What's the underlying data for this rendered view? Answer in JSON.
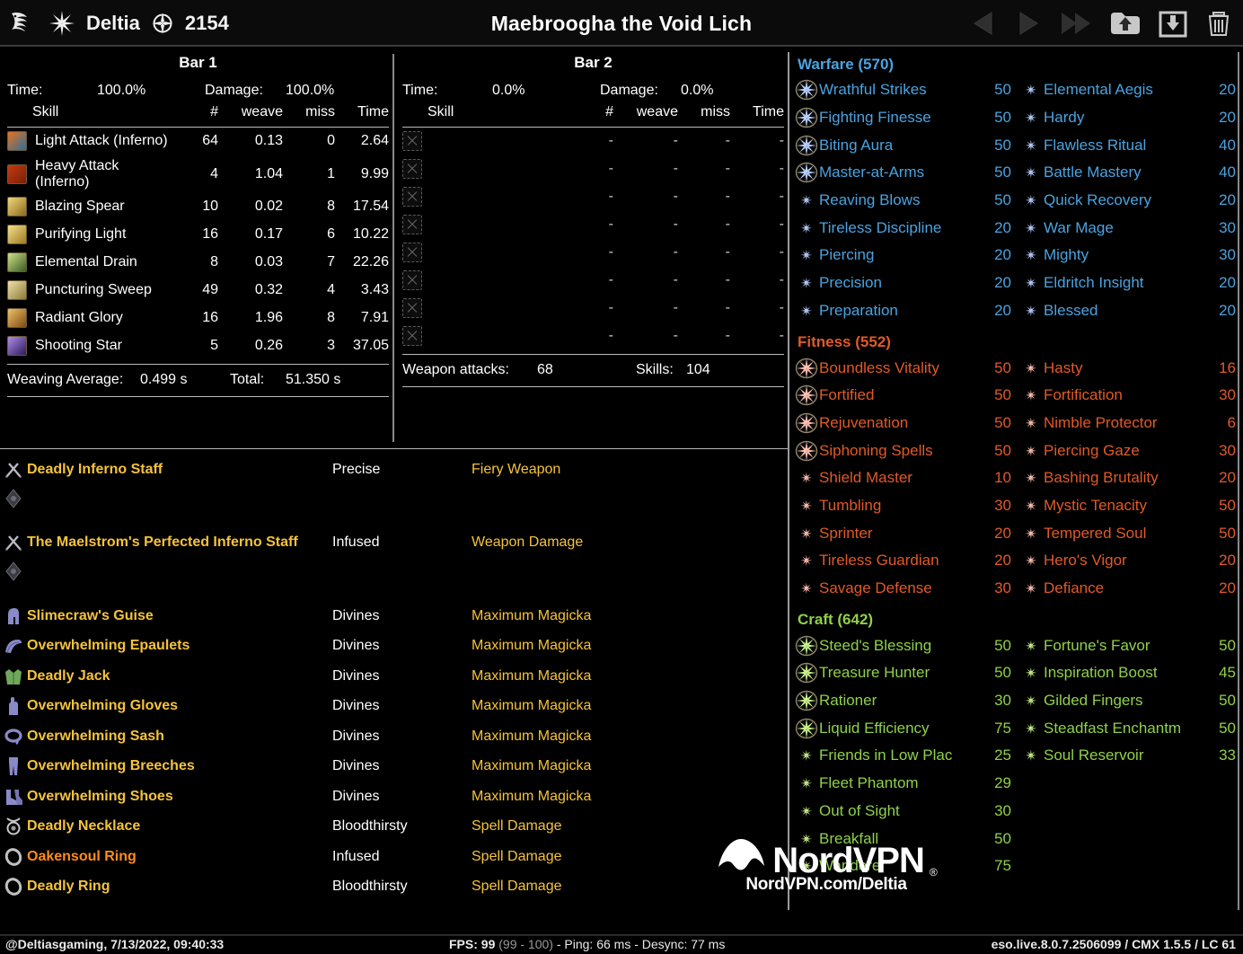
{
  "header": {
    "player_name": "Deltia",
    "cp_count": "2154",
    "title": "Maebroogha the Void Lich",
    "nav_icons": [
      "previous-icon",
      "play-icon",
      "fast-forward-icon",
      "upload-icon",
      "download-icon",
      "trash-icon"
    ]
  },
  "bar1": {
    "title": "Bar 1",
    "time_label": "Time:",
    "time_value": "100.0%",
    "damage_label": "Damage:",
    "damage_value": "100.0%",
    "columns": [
      "Skill",
      "#",
      "weave",
      "miss",
      "Time"
    ],
    "rows": [
      {
        "icon": "light-attack-inferno-icon",
        "name": "Light Attack (Inferno)",
        "count": "64",
        "weave": "0.13",
        "miss": "0",
        "time": "2.64",
        "c1": "#e8731e",
        "c2": "#2c6f9e"
      },
      {
        "icon": "heavy-attack-inferno-icon",
        "name": "Heavy Attack (Inferno)",
        "count": "4",
        "weave": "1.04",
        "miss": "1",
        "time": "9.99",
        "c1": "#c23b10",
        "c2": "#7a1f08"
      },
      {
        "icon": "blazing-spear-icon",
        "name": "Blazing Spear",
        "count": "10",
        "weave": "0.02",
        "miss": "8",
        "time": "17.54",
        "c1": "#f3d77a",
        "c2": "#8a6a1e"
      },
      {
        "icon": "purifying-light-icon",
        "name": "Purifying Light",
        "count": "16",
        "weave": "0.17",
        "miss": "6",
        "time": "10.22",
        "c1": "#f7e08a",
        "c2": "#9a7b22"
      },
      {
        "icon": "elemental-drain-icon",
        "name": "Elemental Drain",
        "count": "8",
        "weave": "0.03",
        "miss": "7",
        "time": "22.26",
        "c1": "#cfe08a",
        "c2": "#3a5a22"
      },
      {
        "icon": "puncturing-sweep-icon",
        "name": "Puncturing Sweep",
        "count": "49",
        "weave": "0.32",
        "miss": "4",
        "time": "3.43",
        "c1": "#f0e2a8",
        "c2": "#8b7a3a"
      },
      {
        "icon": "radiant-glory-icon",
        "name": "Radiant Glory",
        "count": "16",
        "weave": "1.96",
        "miss": "8",
        "time": "7.91",
        "c1": "#f0c268",
        "c2": "#7a4a14"
      },
      {
        "icon": "shooting-star-icon",
        "name": "Shooting Star",
        "count": "5",
        "weave": "0.26",
        "miss": "3",
        "time": "37.05",
        "c1": "#b08ce8",
        "c2": "#2a1a5a"
      }
    ],
    "footer_left_label": "Weaving Average:",
    "footer_left_value": "0.499 s",
    "footer_right_label": "Total:",
    "footer_right_value": "51.350 s"
  },
  "bar2": {
    "title": "Bar 2",
    "time_label": "Time:",
    "time_value": "0.0%",
    "damage_label": "Damage:",
    "damage_value": "0.0%",
    "columns": [
      "Skill",
      "#",
      "weave",
      "miss",
      "Time"
    ],
    "empty_marker": "-",
    "empty_row_count": 8,
    "footer_left_label": "Weapon attacks:",
    "footer_left_value": "68",
    "footer_right_label": "Skills:",
    "footer_right_value": "104"
  },
  "gear": {
    "rows": [
      {
        "icon": "weapon-icon",
        "name": "Deadly Inferno Staff",
        "trait": "Precise",
        "ench": "Fiery Weapon",
        "color": "gold",
        "sub": "glyph-icon"
      },
      {
        "icon": "weapon-icon",
        "name": "The Maelstrom's Perfected Inferno Staff",
        "trait": "Infused",
        "ench": "Weapon Damage",
        "color": "gold",
        "sub": "glyph-icon"
      },
      {
        "icon": "helmet-icon",
        "name": "Slimecraw's Guise",
        "trait": "Divines",
        "ench": "Maximum Magicka",
        "color": "gold"
      },
      {
        "icon": "shoulders-icon",
        "name": "Overwhelming Epaulets",
        "trait": "Divines",
        "ench": "Maximum Magicka",
        "color": "gold"
      },
      {
        "icon": "chest-icon",
        "name": "Deadly Jack",
        "trait": "Divines",
        "ench": "Maximum Magicka",
        "color": "gold"
      },
      {
        "icon": "gloves-icon",
        "name": "Overwhelming Gloves",
        "trait": "Divines",
        "ench": "Maximum Magicka",
        "color": "gold"
      },
      {
        "icon": "belt-icon",
        "name": "Overwhelming Sash",
        "trait": "Divines",
        "ench": "Maximum Magicka",
        "color": "gold"
      },
      {
        "icon": "legs-icon",
        "name": "Overwhelming Breeches",
        "trait": "Divines",
        "ench": "Maximum Magicka",
        "color": "gold"
      },
      {
        "icon": "boots-icon",
        "name": "Overwhelming Shoes",
        "trait": "Divines",
        "ench": "Maximum Magicka",
        "color": "gold"
      },
      {
        "icon": "necklace-icon",
        "name": "Deadly Necklace",
        "trait": "Bloodthirsty",
        "ench": "Spell Damage",
        "color": "gold"
      },
      {
        "icon": "ring-icon",
        "name": "Oakensoul Ring",
        "trait": "Infused",
        "ench": "Spell Damage",
        "color": "orange"
      },
      {
        "icon": "ring-icon",
        "name": "Deadly Ring",
        "trait": "Bloodthirsty",
        "ench": "Spell Damage",
        "color": "gold"
      }
    ]
  },
  "cp": {
    "sections": [
      {
        "name": "Warfare",
        "header": "Warfare (570)",
        "color": "#4aa3e0",
        "star_color": "#b8cfff",
        "rows": [
          {
            "l_slotted": true,
            "l_name": "Wrathful Strikes",
            "l_val": "50",
            "r_slotted": false,
            "r_name": "Elemental Aegis",
            "r_val": "20"
          },
          {
            "l_slotted": true,
            "l_name": "Fighting Finesse",
            "l_val": "50",
            "r_slotted": false,
            "r_name": "Hardy",
            "r_val": "20"
          },
          {
            "l_slotted": true,
            "l_name": "Biting Aura",
            "l_val": "50",
            "r_slotted": false,
            "r_name": "Flawless Ritual",
            "r_val": "40"
          },
          {
            "l_slotted": true,
            "l_name": "Master-at-Arms",
            "l_val": "50",
            "r_slotted": false,
            "r_name": "Battle Mastery",
            "r_val": "40"
          },
          {
            "l_slotted": false,
            "l_name": "Reaving Blows",
            "l_val": "50",
            "r_slotted": false,
            "r_name": "Quick Recovery",
            "r_val": "20"
          },
          {
            "l_slotted": false,
            "l_name": "Tireless Discipline",
            "l_val": "20",
            "r_slotted": false,
            "r_name": "War Mage",
            "r_val": "30"
          },
          {
            "l_slotted": false,
            "l_name": "Piercing",
            "l_val": "20",
            "r_slotted": false,
            "r_name": "Mighty",
            "r_val": "30"
          },
          {
            "l_slotted": false,
            "l_name": "Precision",
            "l_val": "20",
            "r_slotted": false,
            "r_name": "Eldritch Insight",
            "r_val": "20"
          },
          {
            "l_slotted": false,
            "l_name": "Preparation",
            "l_val": "20",
            "r_slotted": false,
            "r_name": "Blessed",
            "r_val": "20"
          }
        ]
      },
      {
        "name": "Fitness",
        "header": "Fitness (552)",
        "color": "#e05a28",
        "star_color": "#ffc0b0",
        "rows": [
          {
            "l_slotted": true,
            "l_name": "Boundless Vitality",
            "l_val": "50",
            "r_slotted": false,
            "r_name": "Hasty",
            "r_val": "16"
          },
          {
            "l_slotted": true,
            "l_name": "Fortified",
            "l_val": "50",
            "r_slotted": false,
            "r_name": "Fortification",
            "r_val": "30"
          },
          {
            "l_slotted": true,
            "l_name": "Rejuvenation",
            "l_val": "50",
            "r_slotted": false,
            "r_name": "Nimble Protector",
            "r_val": "6"
          },
          {
            "l_slotted": true,
            "l_name": "Siphoning Spells",
            "l_val": "50",
            "r_slotted": false,
            "r_name": "Piercing Gaze",
            "r_val": "30"
          },
          {
            "l_slotted": false,
            "l_name": "Shield Master",
            "l_val": "10",
            "r_slotted": false,
            "r_name": "Bashing Brutality",
            "r_val": "20"
          },
          {
            "l_slotted": false,
            "l_name": "Tumbling",
            "l_val": "30",
            "r_slotted": false,
            "r_name": "Mystic Tenacity",
            "r_val": "50"
          },
          {
            "l_slotted": false,
            "l_name": "Sprinter",
            "l_val": "20",
            "r_slotted": false,
            "r_name": "Tempered Soul",
            "r_val": "50"
          },
          {
            "l_slotted": false,
            "l_name": "Tireless Guardian",
            "l_val": "20",
            "r_slotted": false,
            "r_name": "Hero's Vigor",
            "r_val": "20"
          },
          {
            "l_slotted": false,
            "l_name": "Savage Defense",
            "l_val": "30",
            "r_slotted": false,
            "r_name": "Defiance",
            "r_val": "20"
          }
        ]
      },
      {
        "name": "Craft",
        "header": "Craft (642)",
        "color": "#8fd14a",
        "star_color": "#c8f08a",
        "rows": [
          {
            "l_slotted": true,
            "l_name": "Steed's Blessing",
            "l_val": "50",
            "r_slotted": false,
            "r_name": "Fortune's Favor",
            "r_val": "50"
          },
          {
            "l_slotted": true,
            "l_name": "Treasure Hunter",
            "l_val": "50",
            "r_slotted": false,
            "r_name": "Inspiration Boost",
            "r_val": "45"
          },
          {
            "l_slotted": true,
            "l_name": "Rationer",
            "l_val": "30",
            "r_slotted": false,
            "r_name": "Gilded Fingers",
            "r_val": "50"
          },
          {
            "l_slotted": true,
            "l_name": "Liquid Efficiency",
            "l_val": "75",
            "r_slotted": false,
            "r_name": "Steadfast Enchantm",
            "r_val": "50"
          },
          {
            "l_slotted": false,
            "l_name": "Friends in Low Plac",
            "l_val": "25",
            "r_slotted": false,
            "r_name": "Soul Reservoir",
            "r_val": "33"
          },
          {
            "l_slotted": false,
            "l_name": "Fleet Phantom",
            "l_val": "29",
            "r_slotted": false,
            "r_name": "",
            "r_val": ""
          },
          {
            "l_slotted": false,
            "l_name": "Out of Sight",
            "l_val": "30",
            "r_slotted": false,
            "r_name": "",
            "r_val": ""
          },
          {
            "l_slotted": false,
            "l_name": "Breakfall",
            "l_val": "50",
            "r_slotted": false,
            "r_name": "",
            "r_val": ""
          },
          {
            "l_slotted": false,
            "l_name": "Wanderer",
            "l_val": "75",
            "r_slotted": false,
            "r_name": "",
            "r_val": ""
          }
        ]
      }
    ]
  },
  "footer": {
    "left": "@Deltiasgaming, 7/13/2022, 09:40:33",
    "fps_label": "FPS: 99",
    "fps_range": "(99 - 100)",
    "ping": "- Ping: 66 ms - Desync: 77 ms",
    "right": "eso.live.8.0.7.2506099 / CMX 1.5.5 / LC 61"
  },
  "watermark": {
    "brand": "NordVPN",
    "reg": "®",
    "url": "NordVPN.com/Deltia"
  }
}
